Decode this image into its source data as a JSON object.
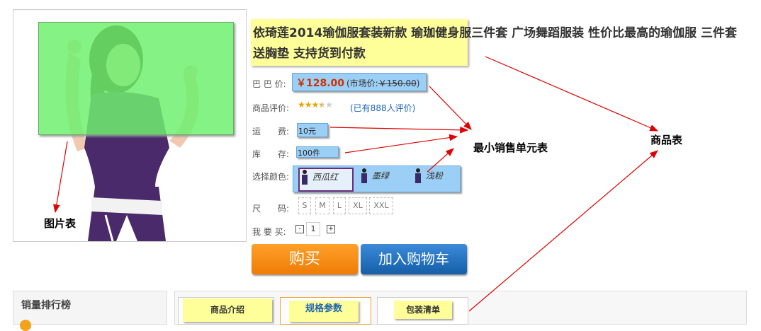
{
  "product": {
    "title": "依琦莲2014瑜伽服套装新款 瑜珈健身服三件套 广场舞蹈服装 性价比最高的瑜伽服 三件套 送胸垫 支持货到付款",
    "price_label": "巴 巴 价:",
    "price": "￥128.00",
    "market_prefix": "(市场价:",
    "market_price": "￥150.00",
    "market_suffix": ")",
    "rating_label": "商品评价:",
    "rating": 3.5,
    "reviews": "(已有888人评价)",
    "shipping_label": "运　　费:",
    "shipping": "10元",
    "stock_label": "库　　存:",
    "stock": "100件",
    "color_label": "选择颜色:",
    "colors": [
      "西瓜红",
      "墨绿",
      "浅粉"
    ],
    "size_label": "尺　　码:",
    "sizes": [
      "S",
      "M",
      "L",
      "XL",
      "XXL"
    ],
    "qty_label": "我 要 买:",
    "qty": "1",
    "qty_minus": "-",
    "qty_plus": "+",
    "buy_button": "购买",
    "cart_button": "加入购物车"
  },
  "sidebar": {
    "title": "销量排行榜"
  },
  "tabs": [
    "商品介绍",
    "规格参数",
    "包装清单"
  ],
  "annotations": {
    "image_table": "图片表",
    "sku_table": "最小销售单元表",
    "product_table": "商品表"
  },
  "colors": {
    "highlight": "#ffff99",
    "blue_box": "#9ccff6",
    "green_box": "#6ef06e",
    "arrow": "#e00000",
    "buy": "#f08a10",
    "cart": "#1e6fc0"
  }
}
